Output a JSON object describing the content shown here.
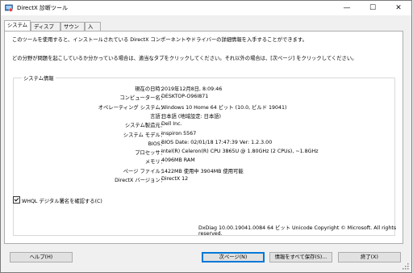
{
  "window": {
    "title": "DirectX 診断ツール",
    "minimize": "—",
    "maximize": "☐",
    "close": "✕"
  },
  "tabs": [
    "システム",
    "ディスプレイ",
    "サウンド",
    "入力"
  ],
  "intro": {
    "line1": "このツールを使用すると、インストールされている DirectX コンポーネントやドライバーの詳細情報を入手することができます。",
    "line2": "どの分野が問題を起こしているか分かっている場合は、適当なタブをクリックしてください。それ以外の場合は、[次ページ] をクリックしてください。"
  },
  "system_info": {
    "group_label": "システム情報",
    "rows": [
      {
        "label": "現在の日時：",
        "value": "2019年12月8日, 8:09:46"
      },
      {
        "label": "コンピューター名：",
        "value": "DESKTOP-O96I871"
      },
      {
        "label": "オペレーティング システム：",
        "value": "Windows 10 Home 64 ビット (10.0, ビルド 19041)"
      },
      {
        "label": "言語：",
        "value": "日本語 (地域設定: 日本語)"
      },
      {
        "label": "システム製造元：",
        "value": "Dell Inc."
      },
      {
        "label": "システム モデル：",
        "value": "Inspiron 5567"
      },
      {
        "label": "BIOS：",
        "value": "BIOS Date: 02/01/18 17:47:39 Ver: 1.2.3.00"
      },
      {
        "label": "プロセッサ：",
        "value": "Intel(R) Celeron(R) CPU 3865U @ 1.80GHz (2 CPUs), ~1.8GHz"
      },
      {
        "label": "メモリ：",
        "value": "4096MB RAM"
      },
      {
        "label": "ページ ファイル：",
        "value": "1422MB 使用中 3904MB 使用可能"
      },
      {
        "label": "DirectX バージョン：",
        "value": "DirectX 12"
      }
    ]
  },
  "whql": {
    "label": "WHQL デジタル署名を確認する(C)",
    "checked": true
  },
  "footer": "DxDiag 10.00.19041.0084 64 ビット Unicode  Copyright © Microsoft. All rights reserved.",
  "buttons": {
    "help": "ヘルプ(H)",
    "next": "次ページ(N)",
    "save_all": "情報をすべて保存(S)...",
    "exit": "終了(X)"
  }
}
